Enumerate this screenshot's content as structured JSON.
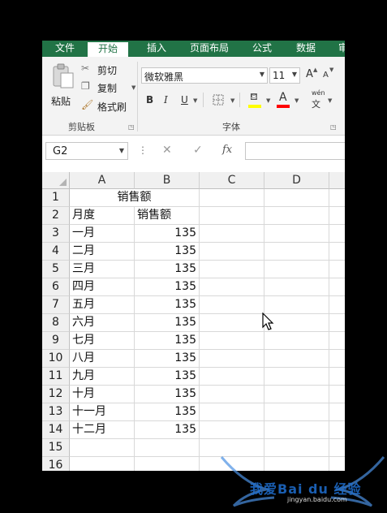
{
  "ribbon": {
    "tabs": [
      "文件",
      "开始",
      "插入",
      "页面布局",
      "公式",
      "数据",
      "审"
    ],
    "active_tab": 1,
    "clipboard": {
      "paste_label": "粘贴",
      "cut_label": "剪切",
      "copy_label": "复制",
      "format_painter_label": "格式刷",
      "group_label": "剪贴板"
    },
    "font": {
      "font_name": "微软雅黑",
      "font_size": "11",
      "bold": "B",
      "italic": "I",
      "underline": "U",
      "grow": "A",
      "shrink": "A",
      "fill_color": "#ffff00",
      "font_color": "#ff0000",
      "phonetic_top": "wén",
      "phonetic_bottom": "文",
      "group_label": "字体"
    }
  },
  "formula_bar": {
    "name_box": "G2",
    "fx": "fx",
    "value": ""
  },
  "sheet": {
    "columns": [
      "A",
      "B",
      "C",
      "D"
    ],
    "row_numbers": [
      "1",
      "2",
      "3",
      "4",
      "5",
      "6",
      "7",
      "8",
      "9",
      "10",
      "11",
      "12",
      "13",
      "14",
      "15",
      "16"
    ],
    "title": "销售额",
    "header": [
      "月度",
      "销售额"
    ],
    "rows": [
      [
        "一月",
        "135"
      ],
      [
        "二月",
        "135"
      ],
      [
        "三月",
        "135"
      ],
      [
        "四月",
        "135"
      ],
      [
        "五月",
        "135"
      ],
      [
        "六月",
        "135"
      ],
      [
        "七月",
        "135"
      ],
      [
        "八月",
        "135"
      ],
      [
        "九月",
        "135"
      ],
      [
        "十月",
        "135"
      ],
      [
        "十一月",
        "135"
      ],
      [
        "十二月",
        "135"
      ]
    ]
  },
  "watermark": {
    "text": "我爱Bai du 经验",
    "url": "jingyan.baidu.com"
  },
  "colors": {
    "excel_green": "#217346",
    "ribbon_bg": "#f3f3f3"
  }
}
